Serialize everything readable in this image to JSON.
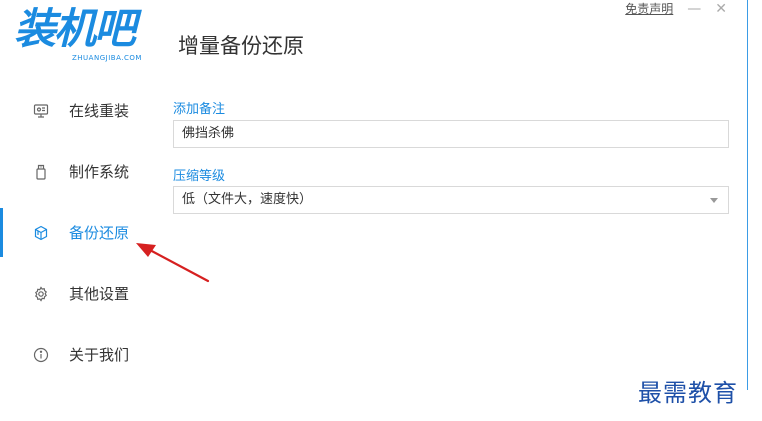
{
  "app": {
    "logo_text": "装机吧",
    "logo_sub": "ZHUANGJIBA.COM",
    "page_title": "增量备份还原",
    "disclaimer_link": "免责声明",
    "minimize_glyph": "—",
    "close_glyph": "✕"
  },
  "sidebar": {
    "items": [
      {
        "label": "在线重装",
        "icon": "monitor-icon",
        "active": false
      },
      {
        "label": "制作系统",
        "icon": "usb-drive-icon",
        "active": false
      },
      {
        "label": "备份还原",
        "icon": "cube-icon",
        "active": true
      },
      {
        "label": "其他设置",
        "icon": "gear-icon",
        "active": false
      },
      {
        "label": "关于我们",
        "icon": "info-icon",
        "active": false
      }
    ]
  },
  "form": {
    "note_label": "添加备注",
    "note_value": "佛挡杀佛",
    "compression_label": "压缩等级",
    "compression_selected": "低（文件大，速度快）"
  },
  "watermark": "最需教育",
  "colors": {
    "accent": "#1b8be0",
    "annotation_arrow": "#d62020",
    "watermark": "#1e50a8"
  }
}
